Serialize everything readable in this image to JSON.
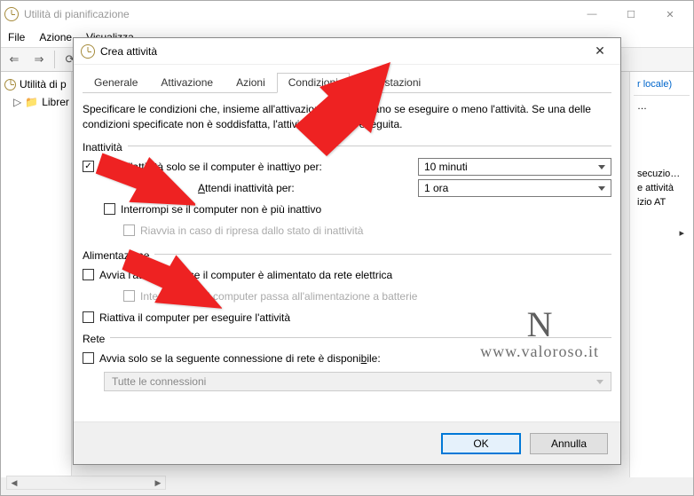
{
  "main_window": {
    "title": "Utilità di pianificazione",
    "menu": {
      "file": "File",
      "azione": "Azione",
      "visualizza": "Visualizza"
    },
    "tree": {
      "root": "Utilità di p",
      "child": "Librer"
    },
    "action_panel": {
      "header": "r locale)",
      "items": [
        "…",
        "secuzio…",
        "e attività",
        "izio AT"
      ],
      "chevron": "▸"
    }
  },
  "dialog": {
    "title": "Crea attività",
    "tabs": {
      "generale": "Generale",
      "attivazione": "Attivazione",
      "azioni": "Azioni",
      "condizioni": "Condizioni",
      "impostazioni": "Impostazioni"
    },
    "description": "Specificare le condizioni che, insieme all'attivazione, determinano se eseguire o meno l'attività. Se una delle condizioni specificate non è soddisfatta, l'attività non verrà eseguita.",
    "group_inactivity": "Inattività",
    "chk_idle_label_pre": "Avvia l'attività solo se il computer è inatti",
    "chk_idle_label_v": "v",
    "chk_idle_label_post": "o per:",
    "sel_idle_value": "10 minuti",
    "wait_label_pre": "A",
    "wait_label_u": "t",
    "wait_label_post": "tendi inattività per:",
    "sel_wait_value": "1 ora",
    "chk_stop_idle": "Interrompi se il computer non è più inattivo",
    "chk_restart_idle": "Riavvia in caso di ripresa dallo stato di inattività",
    "group_power": "Alimentazione",
    "chk_power": "Avvia l'attività solo se il computer è alimentato da rete elettrica",
    "chk_power_batt": "Interrompi se il computer passa all'alimentazione a batterie",
    "chk_wake": "Riattiva il computer per eseguire l'attività",
    "group_net": "Rete",
    "chk_net_pre": "Avvia solo se la seguente connessione di rete è disponi",
    "chk_net_u": "b",
    "chk_net_post": "ile:",
    "sel_net": "Tutte le connessioni",
    "btn_ok": "OK",
    "btn_cancel": "Annulla"
  },
  "watermark": {
    "logo": "N",
    "url": "www.valoroso.it"
  }
}
